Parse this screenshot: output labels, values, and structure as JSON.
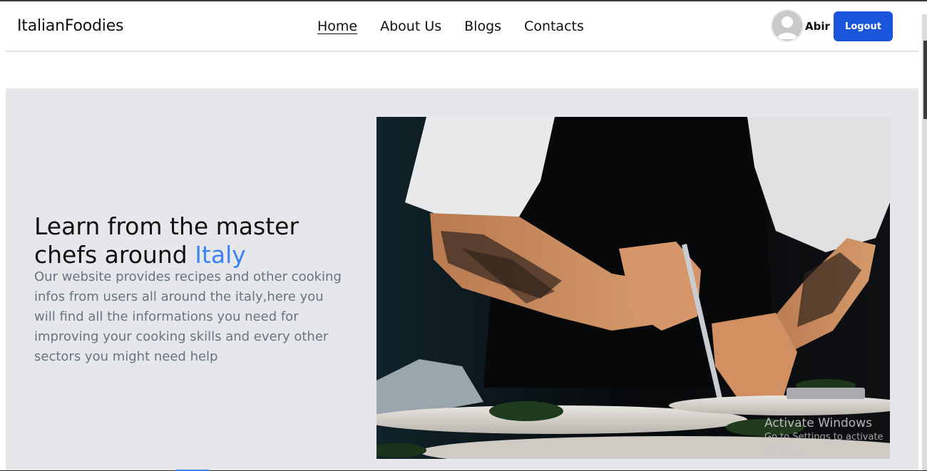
{
  "navbar": {
    "brand": "ItalianFoodies",
    "links": [
      {
        "label": "Home",
        "active": true
      },
      {
        "label": "About Us",
        "active": false
      },
      {
        "label": "Blogs",
        "active": false
      },
      {
        "label": "Contacts",
        "active": false
      }
    ],
    "user": {
      "name": "Abir",
      "avatar_icon": "user-avatar-icon"
    },
    "logout_label": "Logout"
  },
  "hero": {
    "title_main": "Learn from the master chefs around ",
    "title_accent": "Italy",
    "description": "Our website provides recipes and other cooking infos from users all around the italy,here you will find all the informations you need for improving your cooking skills and every other sectors you might need help",
    "image_icon": "chef-plating-photo"
  },
  "watermark": {
    "title": "Activate Windows",
    "subtitle": "Go to Settings to activate Windows."
  },
  "colors": {
    "accent": "#3b82f6",
    "button": "#1a56db",
    "hero_bg": "#e5e7eb",
    "muted_text": "#6b7280"
  }
}
